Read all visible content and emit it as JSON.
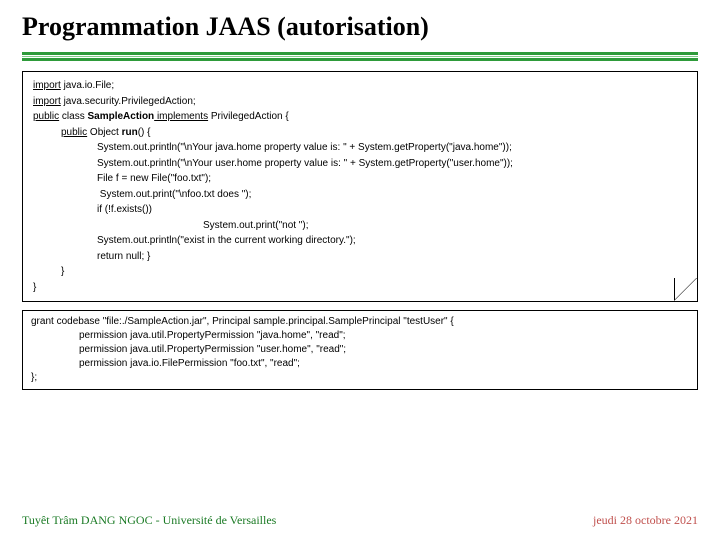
{
  "title": "Programmation JAAS (autorisation)",
  "code": {
    "l1a": "import",
    "l1b": " java.io.File;",
    "l2a": "import",
    "l2b": " java.security.PrivilegedAction;",
    "l3a": "public",
    "l3b": " class ",
    "l3c": "SampleAction",
    "l3d": " implements",
    "l3e": " PrivilegedAction {",
    "l4a": "public",
    "l4b": " Object ",
    "l4c": "run",
    "l4d": "() {",
    "l5": "System.out.println(\"\\nYour java.home property value is: \" + System.getProperty(\"java.home\"));",
    "l6": "System.out.println(\"\\nYour user.home property value is: \" + System.getProperty(\"user.home\"));",
    "l7": "File f = new File(\"foo.txt\");",
    "l8": " System.out.print(\"\\nfoo.txt does \");",
    "l9": "if (!f.exists())",
    "l10": "System.out.print(\"not \");",
    "l11": "System.out.println(\"exist in the current working directory.\");",
    "l12": "return null; }",
    "l13": "}",
    "l14": "}"
  },
  "policy": {
    "p1": "grant codebase \"file:./SampleAction.jar\", Principal sample.principal.SamplePrincipal \"testUser\" {",
    "p2": "permission java.util.PropertyPermission \"java.home\", \"read\";",
    "p3": "permission java.util.PropertyPermission \"user.home\", \"read\";",
    "p4": "permission java.io.FilePermission \"foo.txt\", \"read\";",
    "p5": "};"
  },
  "footer": {
    "left": "Tuyêt Trâm DANG NGOC - Université de Versailles",
    "right": "jeudi 28 octobre 2021"
  }
}
